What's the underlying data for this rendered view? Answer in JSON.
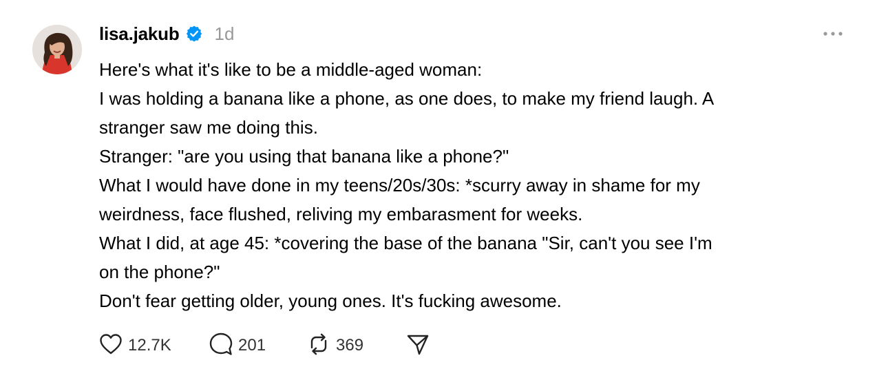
{
  "post": {
    "username": "lisa.jakub",
    "verified": true,
    "time": "1d",
    "lines": [
      "Here's what it's like to be a middle-aged woman:",
      "I was holding a banana like a phone, as one does, to make my friend laugh. A",
      "stranger saw me doing this.",
      "Stranger: \"are you using that banana like a phone?\"",
      "What I would have done in my teens/20s/30s: *scurry away in shame for my",
      "weirdness, face flushed, reliving my embarasment for weeks.",
      "What I did, at age 45: *covering the base of the banana \"Sir, can't you see I'm",
      "on the phone?\"",
      "Don't fear getting older, young ones. It's fucking awesome."
    ],
    "actions": {
      "likes": "12.7K",
      "replies": "201",
      "reposts": "369"
    }
  },
  "icons": {
    "verified": "verified-badge-icon",
    "more": "more-options-icon",
    "like": "heart-icon",
    "reply": "speech-bubble-icon",
    "repost": "repost-icon",
    "share": "paper-plane-icon"
  },
  "colors": {
    "verified_blue": "#0095f6",
    "muted": "#999999",
    "text": "#000000"
  }
}
